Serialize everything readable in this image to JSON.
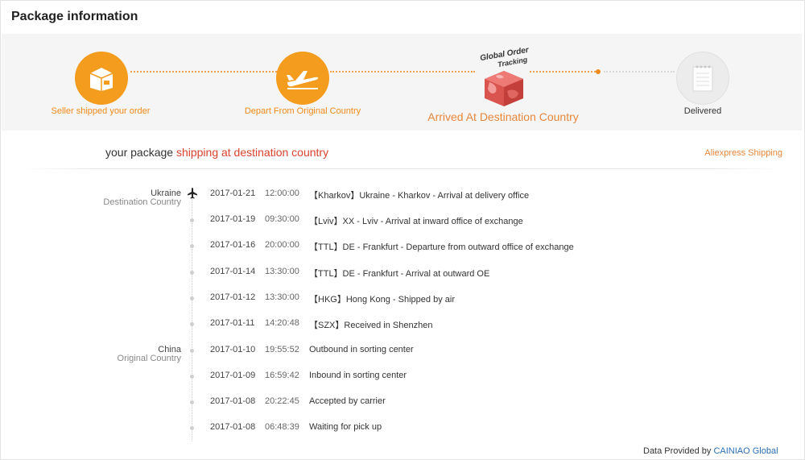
{
  "title": "Package information",
  "steps": [
    {
      "label": "Seller shipped your order",
      "icon": "box-icon",
      "state": "done"
    },
    {
      "label": "Depart From Original Country",
      "icon": "airplane-icon",
      "state": "done"
    },
    {
      "label": "Arrived At Destination Country",
      "icon": "global-order-tracking-cube",
      "state": "current",
      "badge_line1": "Global Order",
      "badge_line2": "Tracking"
    },
    {
      "label": "Delivered",
      "icon": "notepad-icon",
      "state": "pending"
    }
  ],
  "summary": {
    "prefix": "your package",
    "status": "shipping at destination country",
    "carrier": "Aliexpress Shipping"
  },
  "locations": {
    "destination": {
      "country": "Ukraine",
      "role": "Destination Country"
    },
    "origin": {
      "country": "China",
      "role": "Original Country"
    }
  },
  "events": [
    {
      "date": "2017-01-21",
      "time": "12:00:00",
      "desc": "【Kharkov】Ukraine - Kharkov - Arrival at delivery office"
    },
    {
      "date": "2017-01-19",
      "time": "09:30:00",
      "desc": "【Lviv】XX - Lviv - Arrival at inward office of exchange"
    },
    {
      "date": "2017-01-16",
      "time": "20:00:00",
      "desc": "【TTL】DE - Frankfurt - Departure from outward office of exchange"
    },
    {
      "date": "2017-01-14",
      "time": "13:30:00",
      "desc": "【TTL】DE - Frankfurt - Arrival at outward OE"
    },
    {
      "date": "2017-01-12",
      "time": "13:30:00",
      "desc": "【HKG】Hong Kong - Shipped by air"
    },
    {
      "date": "2017-01-11",
      "time": "14:20:48",
      "desc": "【SZX】Received in Shenzhen"
    },
    {
      "date": "2017-01-10",
      "time": "19:55:52",
      "desc": "Outbound in sorting center"
    },
    {
      "date": "2017-01-09",
      "time": "16:59:42",
      "desc": "Inbound in sorting center"
    },
    {
      "date": "2017-01-08",
      "time": "20:22:45",
      "desc": "Accepted by carrier"
    },
    {
      "date": "2017-01-08",
      "time": "06:48:39",
      "desc": "Waiting for pick up"
    }
  ],
  "footer": {
    "prefix": "Data Provided by",
    "link": "CAINIAO Global"
  },
  "colors": {
    "accent": "#f39c1e",
    "highlight": "#d9422c",
    "link": "#2a6fb8"
  }
}
